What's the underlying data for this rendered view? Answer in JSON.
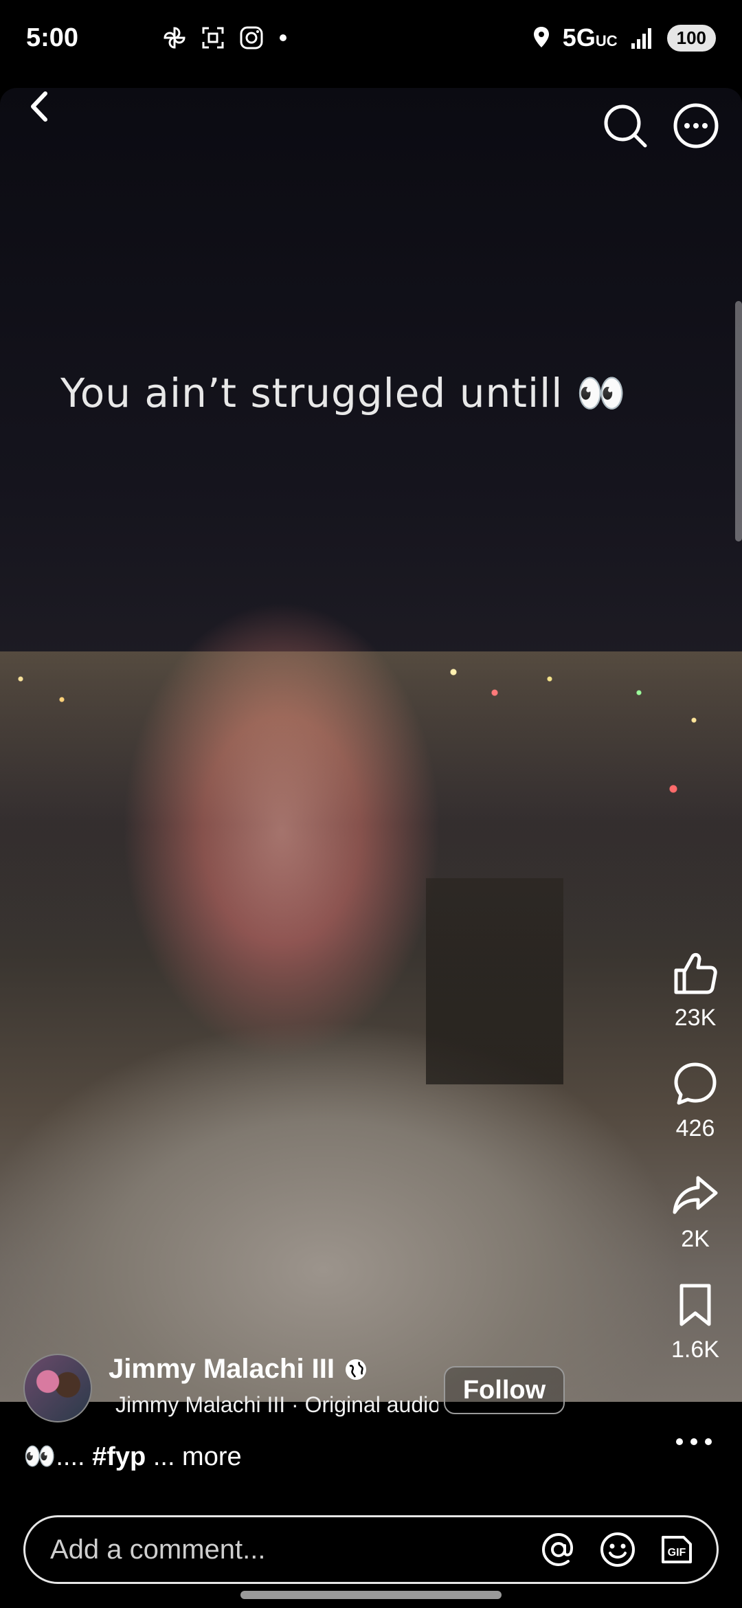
{
  "status_bar": {
    "time": "5:00",
    "network": "5G",
    "network_sub": "UC",
    "battery": "100",
    "icons": [
      "pinwheel-icon",
      "screenshot-icon",
      "instagram-icon",
      "dot-icon",
      "location-icon",
      "signal-icon"
    ]
  },
  "video": {
    "caption_text": "You ain’t struggled untill 👀"
  },
  "actions": {
    "like_count": "23K",
    "comment_count": "426",
    "share_count": "2K",
    "save_count": "1.6K"
  },
  "author": {
    "name": "Jimmy Malachi III",
    "audio": "Jimmy Malachi III · Original audio",
    "follow_label": "Follow"
  },
  "post": {
    "caption_emoji": "👀",
    "caption_dots": "....",
    "hashtag": "#fyp",
    "more_label": "... more"
  },
  "comment_bar": {
    "placeholder": "Add a comment..."
  },
  "colors": {
    "background": "#000000",
    "text": "#ffffff",
    "border": "#e6e6e6"
  }
}
